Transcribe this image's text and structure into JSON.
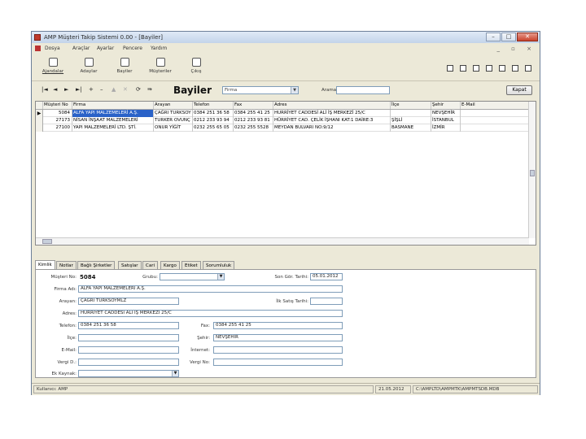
{
  "window": {
    "title": "AMP Müşteri Takip Sistemi 0.00 - [Bayiler]",
    "min": "–",
    "max": "□",
    "close": "✕"
  },
  "menu": [
    "Dosya",
    "Araçlar",
    "Ayarlar",
    "Pencere",
    "Yardım"
  ],
  "mdi_buttons": "_ ▫ ×",
  "toolbar": [
    {
      "label": "Ajandalar",
      "icon": "calendar-icon"
    },
    {
      "label": "Adaylar",
      "icon": "candidate-icon"
    },
    {
      "label": "Bayiler",
      "icon": "dealer-icon"
    },
    {
      "label": "Müşteriler",
      "icon": "customer-icon"
    },
    {
      "label": "Çıkış",
      "icon": "exit-icon"
    }
  ],
  "nav": {
    "buttons": [
      "|◄",
      "◄",
      "►",
      "►|",
      "+",
      "–",
      "▲",
      "✕",
      "⟳",
      "⇛"
    ],
    "title": "Bayiler",
    "filter_field": "Firma",
    "search_label": "Arama",
    "search_value": "",
    "close_label": "Kapat"
  },
  "grid": {
    "columns": [
      "Müşteri No",
      "Firma",
      "Arayan",
      "Telefon",
      "Fax",
      "Adres",
      "İlçe",
      "Şehir",
      "E-Mail"
    ],
    "rows": [
      [
        "5084",
        "ALFA YAPI MALZEMELERİ A.Ş.",
        "ÇAĞRI TURKSOY",
        "0384 251 36 58",
        "0384 255 41 25",
        "HURRİYET CADDESİ ALİ İŞ MERKEZİ 25/C",
        "",
        "NEVŞEHİR",
        ""
      ],
      [
        "27173",
        "NİSAN İNŞAAT MALZEMELERİ",
        "TURKER OVUNÇ",
        "0212 233 93 94",
        "0212 233 93 81",
        "HÜRRİYET CAD. ÇELİK İŞHANI KAT:1 DAİRE:3",
        "ŞİŞLİ",
        "İSTANBUL",
        ""
      ],
      [
        "27100",
        "YAPI MALZEMELERİ LTD. ŞTİ.",
        "ONUR YİĞİT",
        "0232 255 65 05",
        "0232 255 5528",
        "MEYDAN BULVARI NO:9/12",
        "BASMANE",
        "İZMİR",
        ""
      ]
    ]
  },
  "tabs": [
    "Kimlik",
    "Notlar",
    "Bağlı Şirketler",
    "Satışlar",
    "Cari",
    "Kargo",
    "Etiket",
    "Sorumluluk"
  ],
  "form": {
    "musteri_no_label": "Müşteri No:",
    "musteri_no": "5084",
    "grubu_label": "Grubu:",
    "grubu": "",
    "son_gorusme_label": "Son Gör. Tarihi:",
    "son_gorusme": "05.01.2012",
    "firma_adi_label": "Firma Adı:",
    "firma_adi": "ALFA YAPI MALZEMELERİ A.Ş.",
    "arayan_label": "Arayan:",
    "arayan": "ÇAĞRI TURKSOYMLZ",
    "ilk_satis_label": "İlk Satış Tarihi:",
    "ilk_satis": "",
    "adres_label": "Adres:",
    "adres": "HURRİYET CADDESİ ALİ İŞ MERKEZİ 25/C",
    "telefon_label": "Telefon:",
    "telefon": "0384 251 36 58",
    "fax_label": "Fax:",
    "fax": "0384 255 41 25",
    "ilce_label": "İlçe:",
    "ilce": "",
    "sehir_label": "Şehir:",
    "sehir": "NEVŞEHİR",
    "email_label": "E-Mail:",
    "email": "",
    "internet_label": "İnternet:",
    "internet": "",
    "vergi_d_label": "Vergi D.:",
    "vergi_d": "",
    "vergi_no_label": "Vergi No:",
    "vergi_no": "",
    "ek_kaynak_label": "Ek Kaynak:",
    "ek_kaynak": ""
  },
  "status": {
    "user": "Kullanıcı: AMP",
    "date": "21.05.2012",
    "path": "C:\\AMPLTD\\AMPMTK\\AMPMTSDB.MDB"
  }
}
